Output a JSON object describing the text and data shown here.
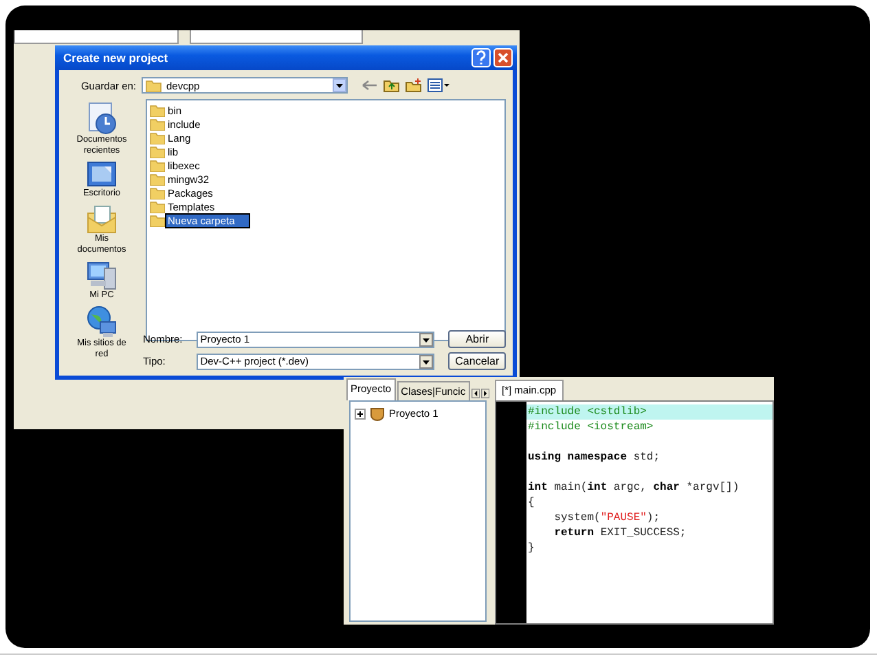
{
  "dialog": {
    "title": "Create new project",
    "look_in": {
      "label": "Guardar en:",
      "value": "devcpp"
    },
    "places": [
      {
        "label": "Documentos recientes",
        "kind": "recent"
      },
      {
        "label": "Escritorio",
        "kind": "desktop"
      },
      {
        "label": "Mis documentos",
        "kind": "documents"
      },
      {
        "label": "Mi PC",
        "kind": "computer"
      },
      {
        "label": "Mis sitios de red",
        "kind": "network"
      }
    ],
    "files": [
      {
        "name": "bin",
        "selected": false
      },
      {
        "name": "include",
        "selected": false
      },
      {
        "name": "Lang",
        "selected": false
      },
      {
        "name": "lib",
        "selected": false
      },
      {
        "name": "libexec",
        "selected": false
      },
      {
        "name": "mingw32",
        "selected": false
      },
      {
        "name": "Packages",
        "selected": false
      },
      {
        "name": "Templates",
        "selected": false
      },
      {
        "name": "Nueva carpeta",
        "selected": true
      }
    ],
    "name_field": {
      "label": "Nombre:",
      "value": "Proyecto 1"
    },
    "type_field": {
      "label": "Tipo:",
      "value": "Dev-C++ project (*.dev)"
    },
    "buttons": [
      "Abrir",
      "Cancelar"
    ]
  },
  "ide": {
    "panel_tabs": [
      {
        "label": "Proyecto",
        "selected": true
      },
      {
        "label": "Clases|Funcic",
        "selected": false
      }
    ],
    "tree": [
      {
        "label": "Proyecto 1",
        "expanded": false
      }
    ],
    "editor_tab": "[*] main.cpp",
    "code": [
      {
        "highlighted": true,
        "tokens": [
          {
            "text": "#include <cstdlib>",
            "kind": "preprocessor"
          }
        ]
      },
      {
        "highlighted": false,
        "tokens": [
          {
            "text": "#include <iostream>",
            "kind": "preprocessor"
          }
        ]
      },
      {
        "highlighted": false
      },
      {
        "highlighted": false,
        "tokens": [
          {
            "text": "using namespace",
            "kind": "keyword"
          },
          {
            "text": " std;",
            "kind": "plain"
          }
        ]
      },
      {
        "highlighted": false
      },
      {
        "highlighted": false,
        "tokens": [
          {
            "text": "int",
            "kind": "keyword"
          },
          {
            "text": " main(",
            "kind": "plain"
          },
          {
            "text": "int",
            "kind": "keyword"
          },
          {
            "text": " argc, ",
            "kind": "plain"
          },
          {
            "text": "char",
            "kind": "keyword"
          },
          {
            "text": " *argv[])",
            "kind": "plain"
          }
        ]
      },
      {
        "highlighted": false,
        "tokens": [
          {
            "text": "{",
            "kind": "plain"
          }
        ]
      },
      {
        "highlighted": false,
        "tokens": [
          {
            "text": "    system(",
            "kind": "plain"
          },
          {
            "text": "\"PAUSE\"",
            "kind": "string"
          },
          {
            "text": ");",
            "kind": "plain"
          }
        ]
      },
      {
        "highlighted": false,
        "tokens": [
          {
            "text": "    return",
            "kind": "keyword"
          },
          {
            "text": " EXIT_SUCCESS;",
            "kind": "plain"
          }
        ]
      },
      {
        "highlighted": false,
        "tokens": [
          {
            "text": "}",
            "kind": "plain"
          }
        ]
      }
    ]
  }
}
